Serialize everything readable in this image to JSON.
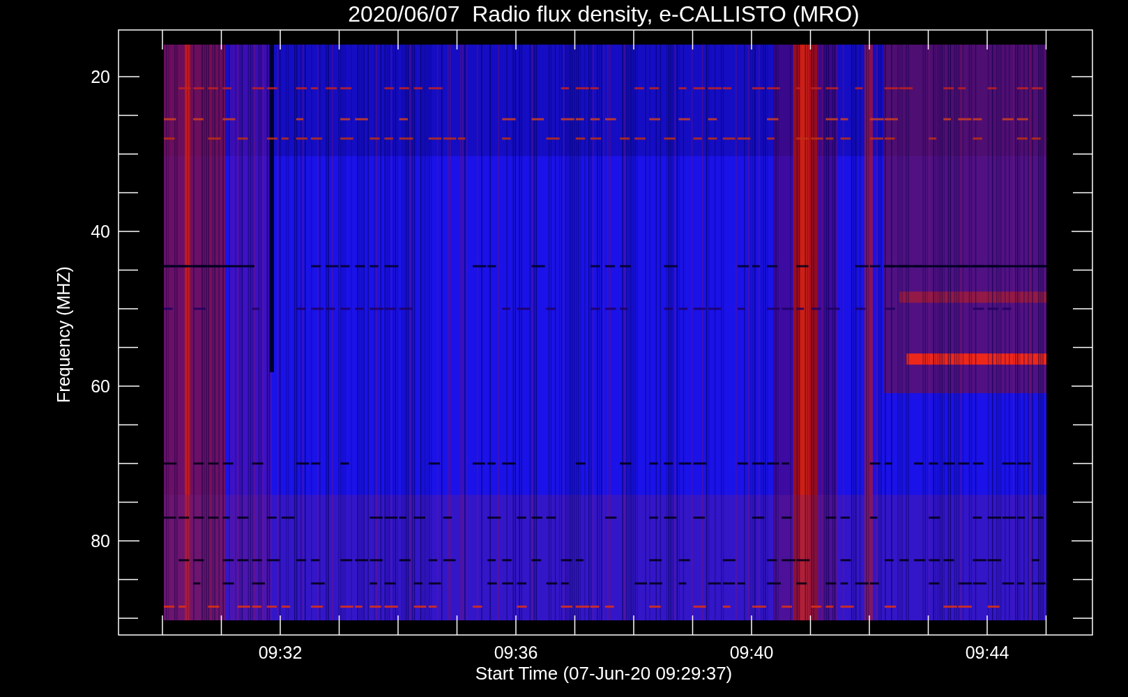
{
  "title": "2020/06/07  Radio flux density, e-CALLISTO (MRO)",
  "y_axis": {
    "label": "Frequency (MHZ)",
    "ticks": [
      "20",
      "40",
      "60",
      "80"
    ]
  },
  "x_axis": {
    "label": "Start Time (07-Jun-20 09:29:37)",
    "ticks": [
      "09:32",
      "09:36",
      "09:40",
      "09:44"
    ]
  }
}
